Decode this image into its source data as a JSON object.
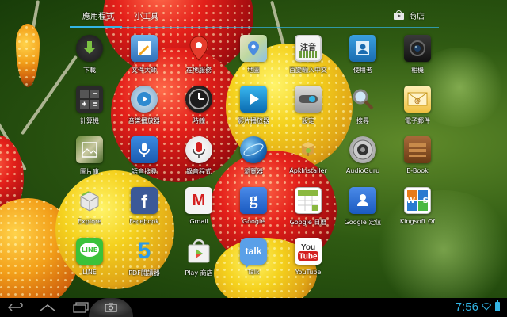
{
  "tabs": {
    "apps": "應用程式",
    "widgets": "小工具",
    "store": "商店"
  },
  "apps": [
    {
      "label": "下載",
      "icon": "download-icon"
    },
    {
      "label": "文件大師",
      "icon": "document-master-icon"
    },
    {
      "label": "在地服務",
      "icon": "local-service-icon"
    },
    {
      "label": "地圖",
      "icon": "maps-icon"
    },
    {
      "label": "百變輸入中文",
      "icon": "chinese-input-icon",
      "glyph": "注音"
    },
    {
      "label": "使用者",
      "icon": "user-icon"
    },
    {
      "label": "相機",
      "icon": "camera-icon"
    },
    {
      "label": "計算機",
      "icon": "calculator-icon"
    },
    {
      "label": "音樂播放器",
      "icon": "music-player-icon"
    },
    {
      "label": "時鐘",
      "icon": "clock-icon"
    },
    {
      "label": "影片播放器",
      "icon": "video-player-icon"
    },
    {
      "label": "設定",
      "icon": "settings-icon"
    },
    {
      "label": "搜尋",
      "icon": "search-icon"
    },
    {
      "label": "電子郵件",
      "icon": "email-icon"
    },
    {
      "label": "圖片庫",
      "icon": "gallery-icon"
    },
    {
      "label": "語音搜尋",
      "icon": "voice-search-icon"
    },
    {
      "label": "錄音程式",
      "icon": "sound-recorder-icon"
    },
    {
      "label": "瀏覽器",
      "icon": "browser-icon"
    },
    {
      "label": "ApkInstaller",
      "icon": "apk-installer-icon"
    },
    {
      "label": "AudioGuru",
      "icon": "audioguru-icon"
    },
    {
      "label": "E-Book",
      "icon": "ebook-icon"
    },
    {
      "label": "Explore",
      "icon": "explore-icon"
    },
    {
      "label": "Facebook",
      "icon": "facebook-icon",
      "glyph": "f"
    },
    {
      "label": "Gmail",
      "icon": "gmail-icon",
      "glyph": "M"
    },
    {
      "label": "Google",
      "icon": "google-search-icon",
      "glyph": "g"
    },
    {
      "label": "Google 日曆",
      "icon": "google-calendar-icon"
    },
    {
      "label": "Google 定位",
      "icon": "google-latitude-icon"
    },
    {
      "label": "Kingsoft Of",
      "icon": "kingsoft-office-icon",
      "glyph": "W S"
    },
    {
      "label": "LINE",
      "icon": "line-icon",
      "glyph": "LINE"
    },
    {
      "label": "PDF閱讀器",
      "icon": "pdf-reader-icon",
      "glyph": "5"
    },
    {
      "label": "Play 商店",
      "icon": "play-store-icon"
    },
    {
      "label": "Talk",
      "icon": "google-talk-icon",
      "glyph": "talk"
    },
    {
      "label": "YouTube",
      "icon": "youtube-icon",
      "glyph": "You Tube"
    }
  ],
  "statusbar": {
    "time": "7:56"
  },
  "colors": {
    "accent": "#33b5e5"
  }
}
